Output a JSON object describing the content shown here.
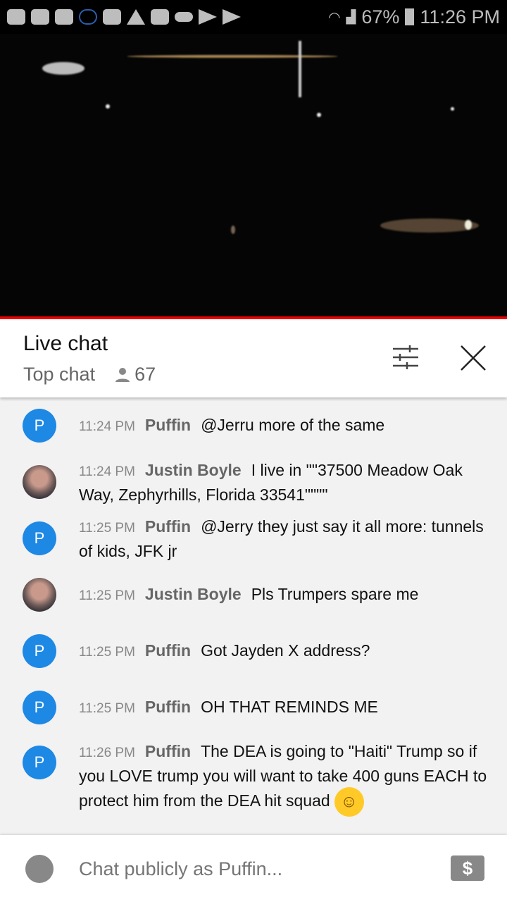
{
  "status_bar": {
    "icons": [
      "youtube-icon",
      "youtube-icon",
      "m-app-icon",
      "cloud-outline-icon",
      "folder-icon",
      "warning-icon",
      "image-icon",
      "cloud-icon",
      "play-store-icon",
      "play-store-icon"
    ],
    "battery": "67%",
    "time": "11:26 PM"
  },
  "header": {
    "title": "Live chat",
    "mode": "Top chat",
    "viewers": "67"
  },
  "messages": [
    {
      "avatar": "P",
      "time": "11:24 PM",
      "author": "Puffin",
      "text": "@Jerru more of the same"
    },
    {
      "avatar": "photo",
      "time": "11:24 PM",
      "author": "Justin Boyle",
      "text": "I live in \"\"37500 Meadow Oak Way, Zephyrhills, Florida 33541\"\"\"\""
    },
    {
      "avatar": "P",
      "time": "11:25 PM",
      "author": "Puffin",
      "text": "@Jerry they just say it all more: tunnels of kids, JFK jr"
    },
    {
      "avatar": "photo",
      "time": "11:25 PM",
      "author": "Justin Boyle",
      "text": "Pls Trumpers spare me"
    },
    {
      "avatar": "P",
      "time": "11:25 PM",
      "author": "Puffin",
      "text": "Got Jayden X address?"
    },
    {
      "avatar": "P",
      "time": "11:25 PM",
      "author": "Puffin",
      "text": "OH THAT REMINDS ME"
    },
    {
      "avatar": "P",
      "time": "11:26 PM",
      "author": "Puffin",
      "text": "The DEA is going to \"Haiti\" Trump so if you LOVE trump you will want to take 400 guns EACH to protect him from the DEA hit squad",
      "emoji": "☺"
    }
  ],
  "input": {
    "placeholder": "Chat publicly as Puffin...",
    "money_symbol": "$"
  },
  "colors": {
    "accent_red": "#ee0000",
    "avatar_blue": "#1e88e5"
  }
}
